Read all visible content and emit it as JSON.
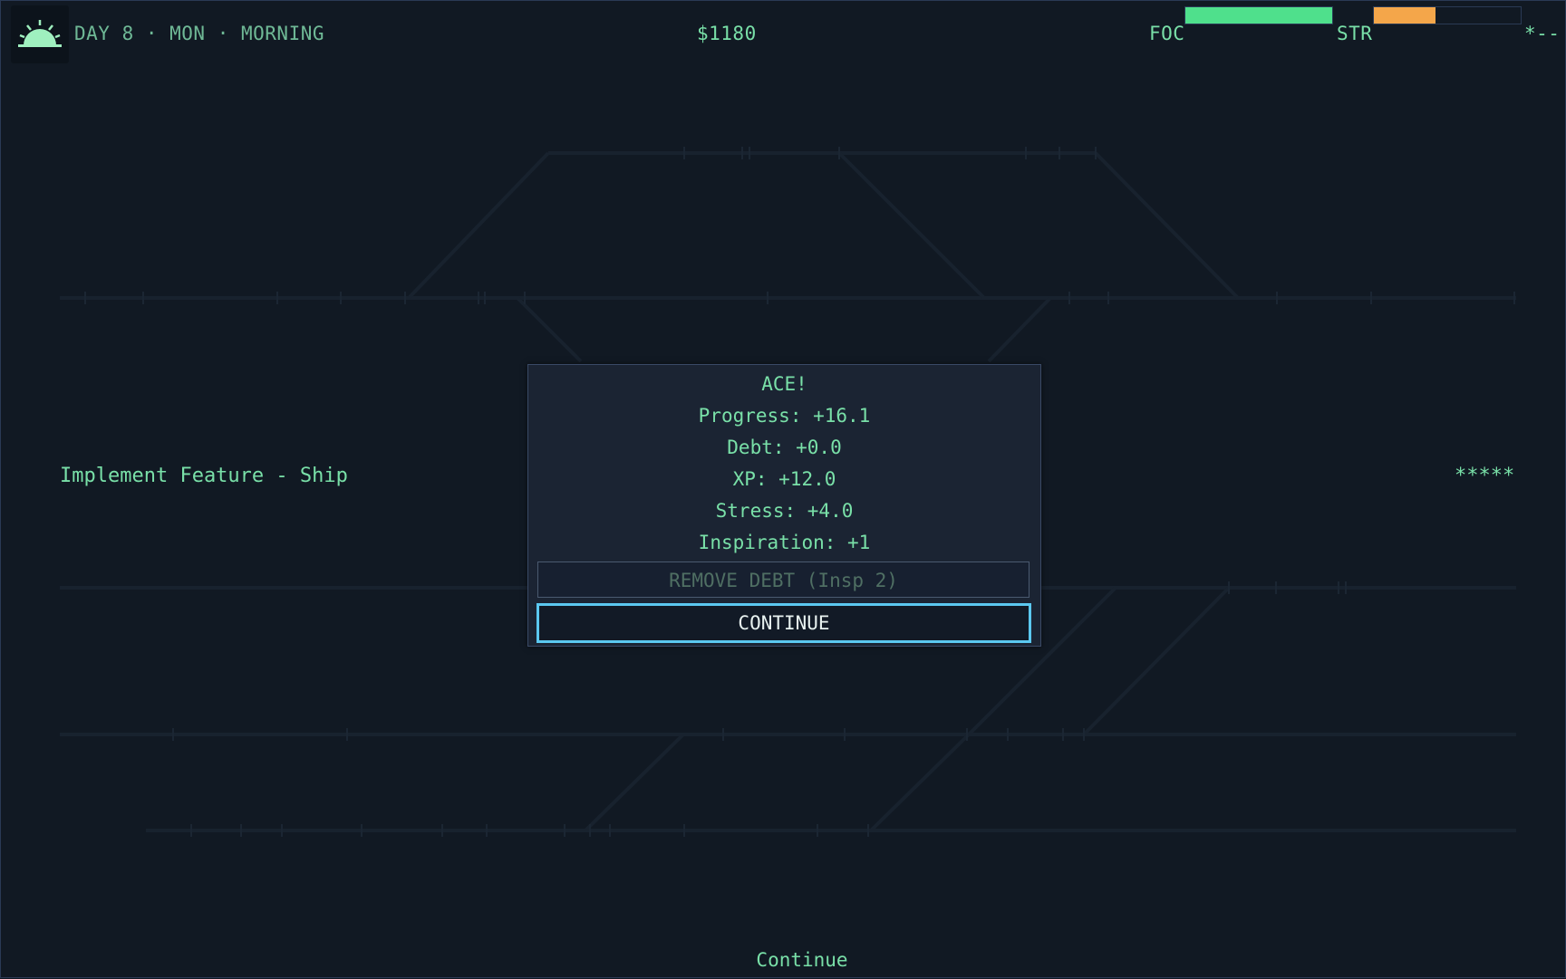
{
  "hud": {
    "day_label": "DAY 8 · MON · MORNING",
    "money": "$1180",
    "focus_label": "FOC",
    "focus_level": 1.0,
    "stress_label": "STR",
    "stress_level": 0.42,
    "rating_stars": "*--",
    "time_icon": "sunrise-icon",
    "colors": {
      "text": "#79e0a8",
      "focus_bar": "#4fe08c",
      "stress_bar": "#f4a64a",
      "accent": "#5bc8f0"
    }
  },
  "task": {
    "name": "Implement Feature - Ship",
    "stars": "*****"
  },
  "result_modal": {
    "title": "ACE!",
    "lines": [
      "Progress: +16.1",
      "Debt: +0.0",
      "XP: +12.0",
      "Stress: +4.0",
      "Inspiration: +1"
    ],
    "remove_debt_label": "REMOVE DEBT (Insp 2)",
    "remove_debt_enabled": false,
    "continue_label": "CONTINUE"
  },
  "footer": {
    "hint": "Continue"
  }
}
